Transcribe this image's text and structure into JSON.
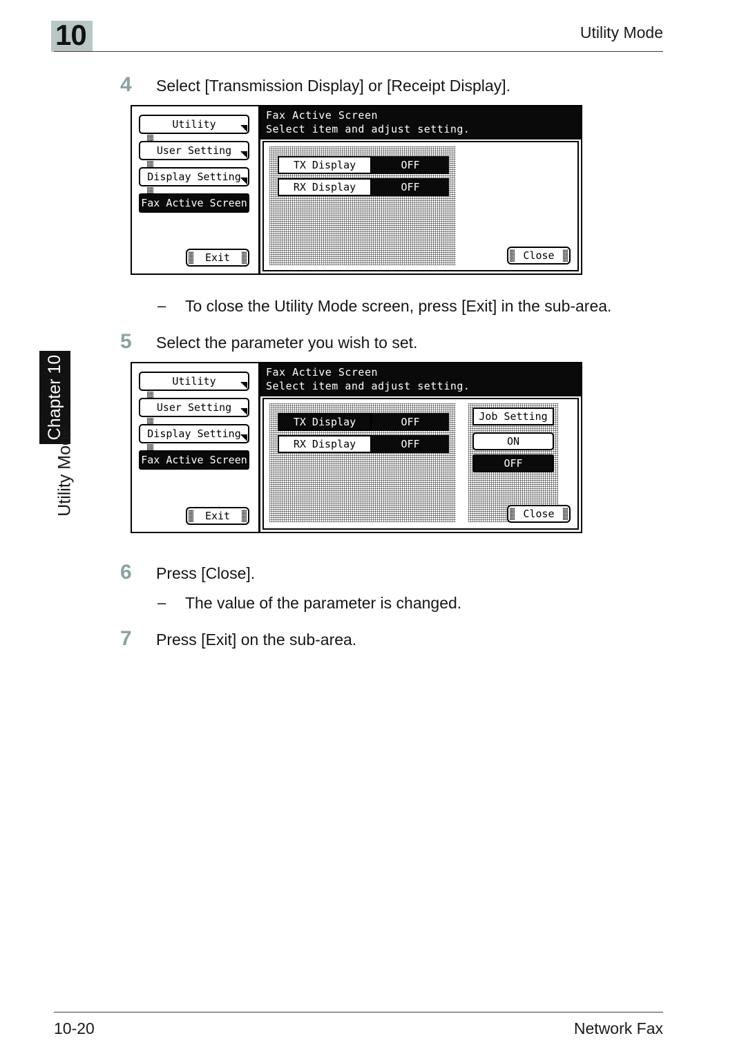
{
  "header": {
    "chapter_number": "10",
    "title": "Utility Mode"
  },
  "side": {
    "chapter_tab": "Chapter 10",
    "running_head": "Utility Mode"
  },
  "footer": {
    "page_number": "10-20",
    "document_title": "Network Fax"
  },
  "steps": [
    {
      "number": "4",
      "text": "Select [Transmission Display] or [Receipt Display]."
    },
    {
      "number": "5",
      "text": "Select the parameter you wish to set."
    },
    {
      "number": "6",
      "text": "Press [Close]."
    },
    {
      "number": "7",
      "text": "Press [Exit] on the sub-area."
    }
  ],
  "notes": [
    {
      "dash": "–",
      "text": "To close the Utility Mode screen, press [Exit] in the sub-area."
    },
    {
      "dash": "–",
      "text": "The value of the parameter is changed."
    }
  ],
  "panel1": {
    "breadcrumbs": [
      {
        "label": "Utility",
        "selected": false
      },
      {
        "label": "User Setting",
        "selected": false
      },
      {
        "label": "Display Setting",
        "selected": false
      },
      {
        "label": "Fax Active Screen",
        "selected": true
      }
    ],
    "exit_label": "Exit",
    "title_line1": "Fax Active Screen",
    "title_line2": "Select item and adjust setting.",
    "settings": [
      {
        "key": "TX Display",
        "value": "OFF",
        "key_selected": false
      },
      {
        "key": "RX Display",
        "value": "OFF",
        "key_selected": false
      }
    ],
    "close_label": "Close"
  },
  "panel2": {
    "breadcrumbs": [
      {
        "label": "Utility",
        "selected": false
      },
      {
        "label": "User Setting",
        "selected": false
      },
      {
        "label": "Display Setting",
        "selected": false
      },
      {
        "label": "Fax Active Screen",
        "selected": true
      }
    ],
    "exit_label": "Exit",
    "title_line1": "Fax Active Screen",
    "title_line2": "Select item and adjust setting.",
    "settings": [
      {
        "key": "TX Display",
        "value": "OFF",
        "key_selected": true
      },
      {
        "key": "RX Display",
        "value": "OFF",
        "key_selected": false
      }
    ],
    "option_column": {
      "header": "Job Setting",
      "options": [
        {
          "label": "ON",
          "selected": false
        },
        {
          "label": "OFF",
          "selected": true
        }
      ]
    },
    "close_label": "Close"
  },
  "colors": {
    "step_number": "#8ba2a2",
    "chapter_badge": "#b9c6c6",
    "tab_background": "#121212",
    "lcd_ink": "#0a0a0a",
    "text": "#151515"
  }
}
